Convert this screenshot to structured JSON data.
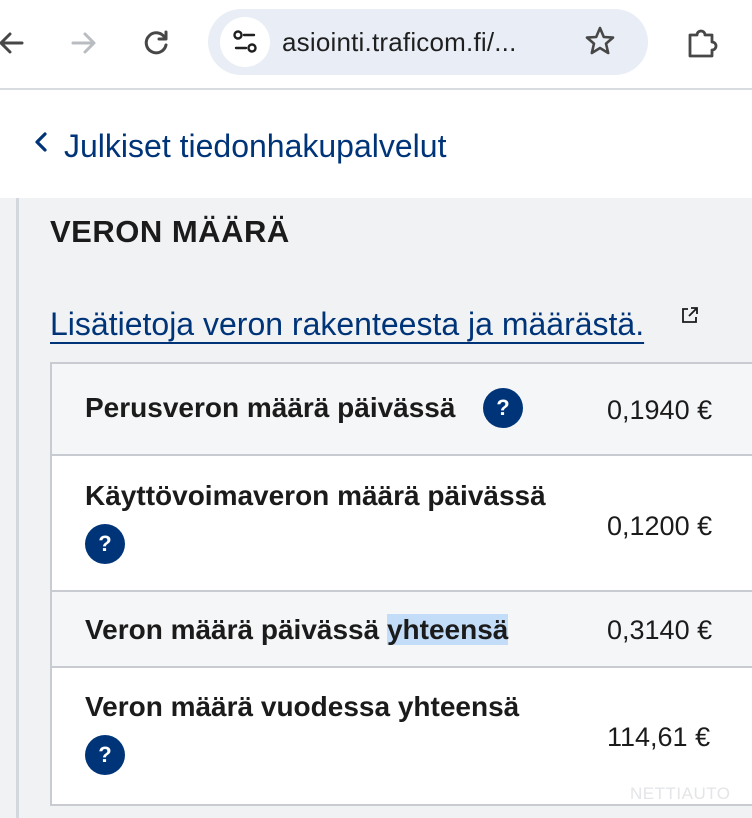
{
  "browser": {
    "url": "asiointi.traficom.fi/...",
    "icons": [
      "back-arrow-icon",
      "forward-arrow-icon",
      "reload-icon",
      "site-info-icon",
      "bookmark-star-icon",
      "extensions-icon"
    ]
  },
  "nav": {
    "back_link": "Julkiset tiedonhakupalvelut",
    "back_icon": "chevron-left-icon"
  },
  "section": {
    "title": "VERON MÄÄRÄ",
    "info_link": "Lisätietoja veron rakenteesta ja määrästä.",
    "info_link_icon": "external-link-icon"
  },
  "tax_rows": [
    {
      "label": "Perusveron määrä päivässä",
      "value": "0,1940 €",
      "help": "?"
    },
    {
      "label": "Käyttövoimaveron määrä päivässä",
      "value": "0,1200 €",
      "help": "?"
    },
    {
      "label_prefix": "Veron määrä päivässä ",
      "label_highlight": "yhteensä",
      "value": "0,3140 €"
    },
    {
      "label": "Veron määrä vuodessa yhteensä",
      "value": "114,61 €",
      "help": "?"
    }
  ],
  "watermark": "NETTIAUTO",
  "colors": {
    "link": "#003479",
    "help_badge": "#003479",
    "content_bg": "#f1f2f4",
    "selection": "#c3dcf7"
  }
}
